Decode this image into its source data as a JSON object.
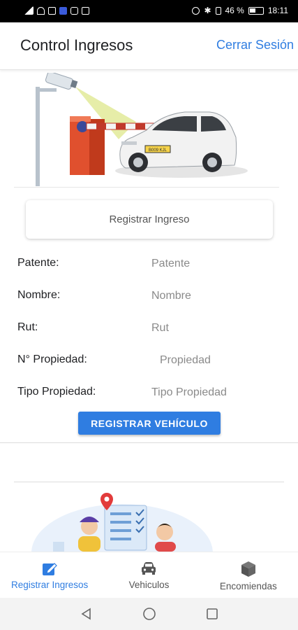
{
  "status_bar": {
    "battery_text": "46 %",
    "time": "18:11"
  },
  "app_bar": {
    "title": "Control Ingresos",
    "logout_label": "Cerrar Sesión"
  },
  "hero": {
    "plate_text": "B009 KJL",
    "icon": "parking-barrier-car-illustration"
  },
  "register_card": {
    "label": "Registrar Ingreso"
  },
  "form": {
    "fields": [
      {
        "label": "Patente:",
        "placeholder": "Patente"
      },
      {
        "label": "Nombre:",
        "placeholder": "Nombre"
      },
      {
        "label": "Rut:",
        "placeholder": "Rut"
      },
      {
        "label": "N° Propiedad:",
        "placeholder": "Propiedad"
      },
      {
        "label": "Tipo Propiedad:",
        "placeholder": "Tipo Propiedad"
      }
    ],
    "submit_label": "REGISTRAR VEHÍCULO"
  },
  "bottom_nav": {
    "items": [
      {
        "label": "Registrar Ingresos",
        "icon": "edit-square-icon",
        "active": true
      },
      {
        "label": "Vehiculos",
        "icon": "car-icon",
        "active": false
      },
      {
        "label": "Encomiendas",
        "icon": "package-box-icon",
        "active": false
      }
    ]
  },
  "colors": {
    "accent": "#2f7de1",
    "text": "#202124",
    "placeholder": "#8a8a8a"
  }
}
